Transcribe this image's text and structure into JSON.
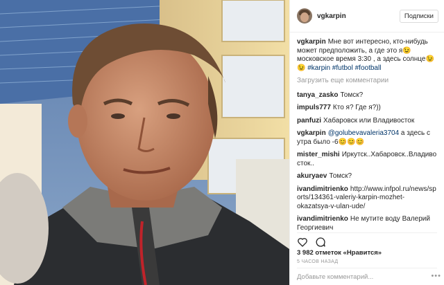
{
  "post": {
    "username": "vgkarpin",
    "follow_label": "Подписки",
    "caption": {
      "user": "vgkarpin",
      "text": "Мне вот интересно, кто-нибудь может предположить, а где это я😉 московское время 3:30 , а здесь солнце😉😉",
      "tags": "#karpin #futbol #football"
    },
    "load_more": "Загрузить еще комментарии",
    "comments": [
      {
        "user": "tanya_zasko",
        "text": "Томск?"
      },
      {
        "user": "impuls777",
        "text": "Кто я? Где я?))"
      },
      {
        "user": "panfuzi",
        "text": "Хабаровск или Владивосток"
      },
      {
        "user": "vgkarpin",
        "mention": "@golubevavaleria3704",
        "text": "а здесь с утра было -6😊😊😊"
      },
      {
        "user": "mister_mishi",
        "text": "Иркутск..Хабаровск..Владиво сток.."
      },
      {
        "user": "akuryaev",
        "text": "Томск?"
      },
      {
        "user": "ivandimitrienko",
        "text": "http://www.infpol.ru/news/sports/134361-valeriy-karpin-mozhet-okazatsya-v-ulan-ude/"
      },
      {
        "user": "ivandimitrienko",
        "text": "Не мутите воду Валерий Георгиевич"
      }
    ],
    "likes": "3 982 отметок «Нравится»",
    "time": "5 часов назад",
    "add_comment_placeholder": "Добавьте комментарий...",
    "more_icon": "•••"
  },
  "icons": {
    "like": "heart-icon",
    "comment": "comment-icon"
  }
}
